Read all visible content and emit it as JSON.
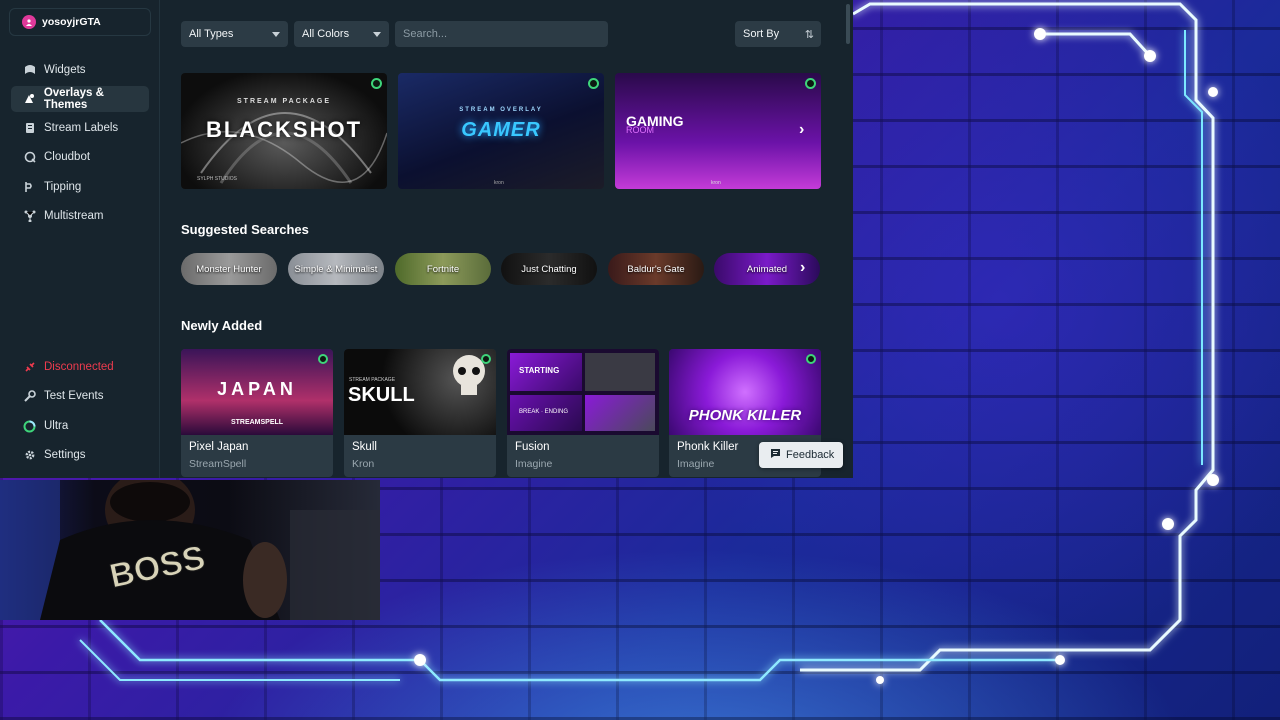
{
  "user": {
    "name": "yosoyjrGTA"
  },
  "sidebar": {
    "items": [
      {
        "label": "Widgets",
        "icon": "widgets-icon"
      },
      {
        "label": "Overlays & Themes",
        "icon": "themes-icon",
        "active": true
      },
      {
        "label": "Stream Labels",
        "icon": "labels-icon"
      },
      {
        "label": "Cloudbot",
        "icon": "cloudbot-icon"
      },
      {
        "label": "Tipping",
        "icon": "tipping-icon"
      },
      {
        "label": "Multistream",
        "icon": "multistream-icon"
      }
    ],
    "bottom": [
      {
        "label": "Disconnected",
        "icon": "disconnected-icon",
        "color": "#ee3b4e"
      },
      {
        "label": "Test Events",
        "icon": "wrench-icon"
      },
      {
        "label": "Ultra",
        "icon": "ultra-icon"
      },
      {
        "label": "Settings",
        "icon": "gear-icon"
      }
    ]
  },
  "filters": {
    "types": "All Types",
    "colors": "All Colors",
    "search_placeholder": "Search...",
    "sort": "Sort By"
  },
  "featured": [
    {
      "title": "BLACKSHOT",
      "subtitle": "STREAM PACKAGE",
      "label": "SYLPH STUDIOS"
    },
    {
      "title": "GAMER",
      "subtitle": "STREAM OVERLAY",
      "label": "kron"
    },
    {
      "title": "GAMING",
      "subtitle": "ROOM",
      "label": "kron"
    }
  ],
  "suggested": {
    "title": "Suggested Searches",
    "pills": [
      "Monster Hunter",
      "Simple & Minimalist",
      "Fortnite",
      "Just Chatting",
      "Baldur's Gate",
      "Animated"
    ]
  },
  "newly_added": {
    "title": "Newly Added",
    "items": [
      {
        "name": "Pixel Japan",
        "author": "StreamSpell",
        "thumb_text": "JAPAN",
        "thumb_sub": "STREAMSPELL"
      },
      {
        "name": "Skull",
        "author": "Kron",
        "thumb_text": "SKULL",
        "thumb_sub": "STREAM PACKAGE"
      },
      {
        "name": "Fusion",
        "author": "Imagine",
        "thumb_text": "STARTING",
        "thumb_sub": "BREAK · ENDING"
      },
      {
        "name": "Phonk Killer",
        "author": "Imagine",
        "thumb_text": "PHONK KILLER",
        "thumb_sub": ""
      }
    ]
  },
  "feedback": {
    "label": "Feedback"
  },
  "webcam": {
    "shirt_text": "BOSS"
  }
}
